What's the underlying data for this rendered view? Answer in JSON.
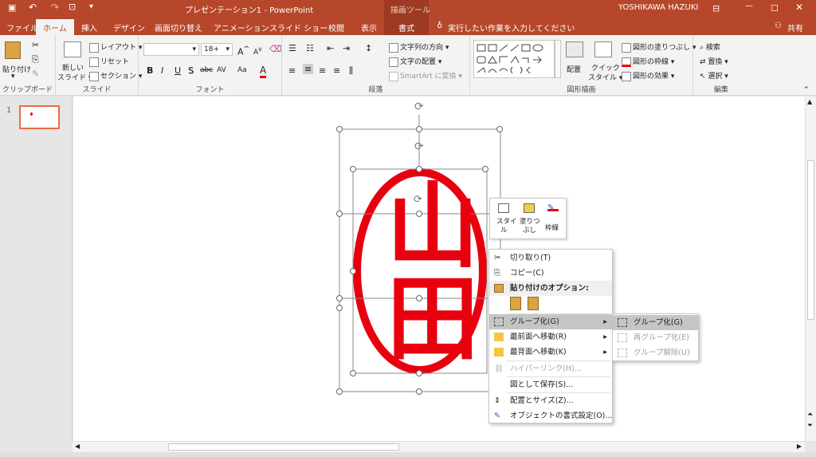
{
  "titlebar": {
    "save_icon": "save-icon",
    "undo_icon": "undo-icon",
    "redo_icon": "redo-icon",
    "present_icon": "present-from-start-icon",
    "customize_icon": "customize-qat-icon",
    "title": "プレゼンテーション1  -  PowerPoint",
    "context_tab": "描画ツール",
    "user": "YOSHIKAWA HAZUKI",
    "ribbon_opts_icon": "ribbon-display-options-icon",
    "min_icon": "minimize-icon",
    "max_icon": "maximize-icon",
    "close_icon": "close-icon"
  },
  "tabs": {
    "file": "ファイル",
    "home": "ホーム",
    "insert": "挿入",
    "design": "デザイン",
    "transitions": "画面切り替え",
    "animations": "アニメーション",
    "slideshow": "スライド ショー",
    "review": "校閲",
    "view": "表示",
    "format": "書式",
    "tellme": "実行したい作業を入力してください",
    "share": "共有"
  },
  "ribbon": {
    "clipboard": {
      "paste": "貼り付け",
      "paste_arrow": "▾",
      "label": "クリップボード"
    },
    "slides": {
      "new_slide": "新しい",
      "new_slide2": "スライド ▾",
      "layout": "レイアウト ▾",
      "reset": "リセット",
      "section": "セクション ▾",
      "label": "スライド"
    },
    "font": {
      "font_name": "",
      "font_size": "18+",
      "bold": "B",
      "italic": "I",
      "underline": "U",
      "shadow": "S",
      "strike": "abc",
      "spacing": "AV",
      "case": "Aa",
      "color": "A",
      "grow": "A",
      "shrink": "A",
      "label": "フォント"
    },
    "paragraph": {
      "text_direction": "文字列の方向 ▾",
      "align_text": "文字の配置 ▾",
      "smartart": "SmartArt に変換 ▾",
      "label": "段落"
    },
    "drawing": {
      "arrange": "配置",
      "quick_styles": "クイック",
      "quick_styles2": "スタイル ▾",
      "fill": "図形の塗りつぶし ▾",
      "outline": "図形の枠線 ▾",
      "effects": "図形の効果 ▾",
      "label": "図形描画"
    },
    "editing": {
      "find": "検索",
      "replace": "置換 ▾",
      "select": "選択 ▾",
      "label": "編集"
    }
  },
  "slides": {
    "number": "1"
  },
  "stamp": {
    "text": "山田",
    "color": "#e8000f"
  },
  "minitoolbar": {
    "style": "スタイ",
    "style2": "ル",
    "fill": "塗りつ",
    "fill2": "ぶし",
    "outline": "枠線"
  },
  "context_menu": {
    "items": [
      "切り取り(T)",
      "コピー(C)",
      "貼り付けのオプション:",
      "グループ化(G)",
      "最前面へ移動(R)",
      "最背面へ移動(K)",
      "ハイパーリンク(H)...",
      "図として保存(S)...",
      "配置とサイズ(Z)...",
      "オブジェクトの書式設定(O)..."
    ]
  },
  "submenu": {
    "items": [
      "グループ化(G)",
      "再グループ化(E)",
      "グループ解除(U)"
    ]
  },
  "colors": {
    "accent": "#b7472a",
    "selected": "#c5c5c5"
  }
}
